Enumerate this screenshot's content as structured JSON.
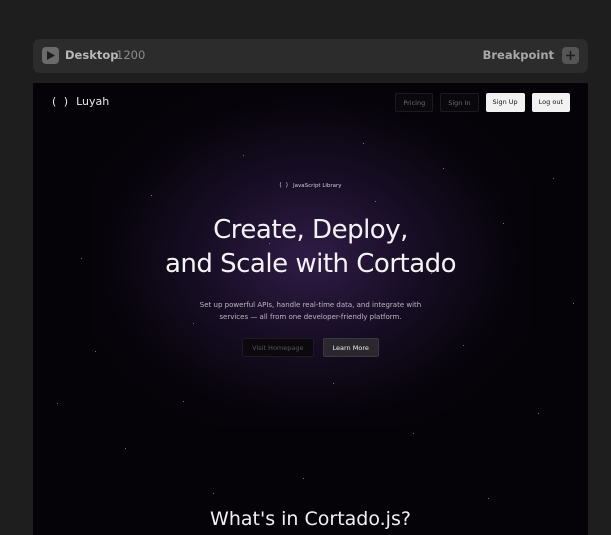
{
  "toolbar": {
    "device_label": "Desktop",
    "width_value": "1200",
    "breakpoint_label": "Breakpoint"
  },
  "site": {
    "brand_mark": "( )",
    "brand_name": "Luyah",
    "nav": {
      "pricing": "Pricing",
      "sign_in": "Sign In",
      "sign_up": "Sign Up",
      "log_out": "Log out"
    },
    "badge": {
      "mark": "( )",
      "text": "JavaScript Library"
    },
    "headline": {
      "line1": "Create, Deploy,",
      "line2": "and Scale with Cortado"
    },
    "subtitle": {
      "line1": "Set up powerful APIs, handle real-time data, and integrate with",
      "line2": "services — all from one developer-friendly platform."
    },
    "cta": {
      "secondary": "Visit Homepage",
      "primary": "Learn More"
    },
    "section_title": "What's in Cortado.js?"
  },
  "colors": {
    "editor_bg": "#1e1e1e",
    "toolbar_bg": "#2c2c2c",
    "preview_bg": "#050308",
    "glow": "#3e245c"
  }
}
